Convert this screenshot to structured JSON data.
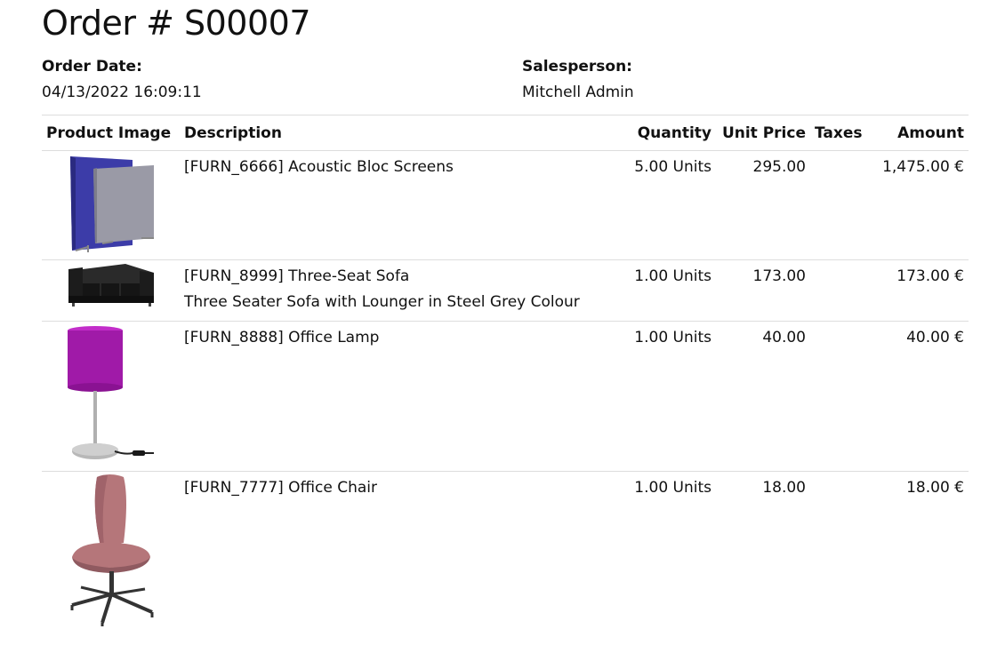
{
  "order": {
    "title": "Order # S00007",
    "date_label": "Order Date:",
    "date_value": "04/13/2022 16:09:11",
    "salesperson_label": "Salesperson:",
    "salesperson_value": "Mitchell Admin"
  },
  "table": {
    "headers": {
      "image": "Product Image",
      "description": "Description",
      "quantity": "Quantity",
      "unit_price": "Unit Price",
      "taxes": "Taxes",
      "amount": "Amount"
    },
    "rows": [
      {
        "image_icon": "acoustic-screens-image",
        "description": "[FURN_6666] Acoustic Bloc Screens",
        "description_extra": "",
        "quantity": "5.00 Units",
        "unit_price": "295.00",
        "taxes": "",
        "amount": "1,475.00 €"
      },
      {
        "image_icon": "sofa-image",
        "description": "[FURN_8999] Three-Seat Sofa",
        "description_extra": "Three Seater Sofa with Lounger in Steel Grey Colour",
        "quantity": "1.00 Units",
        "unit_price": "173.00",
        "taxes": "",
        "amount": "173.00 €"
      },
      {
        "image_icon": "office-lamp-image",
        "description": "[FURN_8888] Office Lamp",
        "description_extra": "",
        "quantity": "1.00 Units",
        "unit_price": "40.00",
        "taxes": "",
        "amount": "40.00 €"
      },
      {
        "image_icon": "office-chair-image",
        "description": "[FURN_7777] Office Chair",
        "description_extra": "",
        "quantity": "1.00 Units",
        "unit_price": "18.00",
        "taxes": "",
        "amount": "18.00 €"
      }
    ]
  },
  "colors": {
    "screen_front": "#3c3ca8",
    "screen_back": "#9a9aa6",
    "sofa": "#1c1c1c",
    "lamp_shade": "#a01aa8",
    "lamp_base": "#b8b8b8",
    "chair_seat": "#b5767a",
    "chair_base": "#333333"
  }
}
